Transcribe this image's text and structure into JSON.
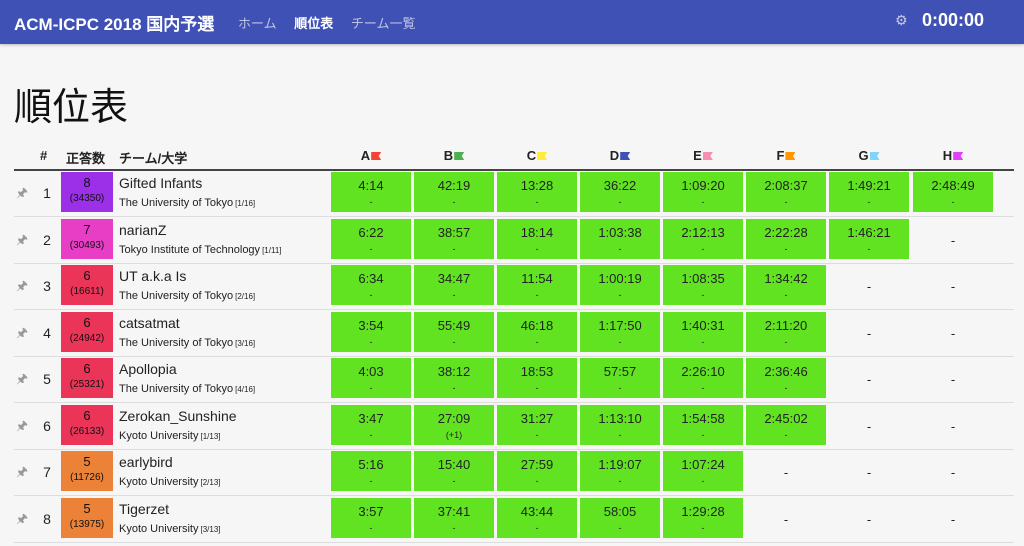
{
  "navbar": {
    "brand": "ACM-ICPC 2018 国内予選",
    "links": [
      "ホーム",
      "順位表",
      "チーム一覧"
    ],
    "active_index": 1,
    "timer": "0:00:00",
    "gear_icon": "gear-icon"
  },
  "page_title": "順位表",
  "headers": {
    "rank": "#",
    "solved": "正答数",
    "team": "チーム/大学"
  },
  "problems": [
    {
      "label": "A",
      "color": "#f44336"
    },
    {
      "label": "B",
      "color": "#4caf50"
    },
    {
      "label": "C",
      "color": "#ffeb3b"
    },
    {
      "label": "D",
      "color": "#3f51b5"
    },
    {
      "label": "E",
      "color": "#f48fb1"
    },
    {
      "label": "F",
      "color": "#ff9800"
    },
    {
      "label": "G",
      "color": "#81d4fa"
    },
    {
      "label": "H",
      "color": "#e040fb"
    }
  ],
  "colors": {
    "accepted": "#62e322",
    "header": "#3f51b5"
  },
  "teams": [
    {
      "rank": "1",
      "solved": "8",
      "penalty": "(34350)",
      "color": "#9b30e8",
      "name": "Gifted Infants",
      "university": "The University of Tokyo",
      "univ_rank": "[1/16]",
      "cells": [
        {
          "t": "4:14",
          "s": "-"
        },
        {
          "t": "42:19",
          "s": "-"
        },
        {
          "t": "13:28",
          "s": "-"
        },
        {
          "t": "36:22",
          "s": "-"
        },
        {
          "t": "1:09:20",
          "s": "-"
        },
        {
          "t": "2:08:37",
          "s": "-"
        },
        {
          "t": "1:49:21",
          "s": "-"
        },
        {
          "t": "2:48:49",
          "s": "-"
        }
      ]
    },
    {
      "rank": "2",
      "solved": "7",
      "penalty": "(30493)",
      "color": "#e83ec5",
      "name": "narianZ",
      "university": "Tokyo Institute of Technology",
      "univ_rank": "[1/11]",
      "cells": [
        {
          "t": "6:22",
          "s": "-"
        },
        {
          "t": "38:57",
          "s": "-"
        },
        {
          "t": "18:14",
          "s": "-"
        },
        {
          "t": "1:03:38",
          "s": "-"
        },
        {
          "t": "2:12:13",
          "s": "-"
        },
        {
          "t": "2:22:28",
          "s": "-"
        },
        {
          "t": "1:46:21",
          "s": "-"
        },
        {
          "t": "-",
          "s": ""
        }
      ]
    },
    {
      "rank": "3",
      "solved": "6",
      "penalty": "(16611)",
      "color": "#ea3458",
      "name": "UT a.k.a Is",
      "university": "The University of Tokyo",
      "univ_rank": "[2/16]",
      "cells": [
        {
          "t": "6:34",
          "s": "-"
        },
        {
          "t": "34:47",
          "s": "-"
        },
        {
          "t": "11:54",
          "s": "-"
        },
        {
          "t": "1:00:19",
          "s": "-"
        },
        {
          "t": "1:08:35",
          "s": "-"
        },
        {
          "t": "1:34:42",
          "s": "-"
        },
        {
          "t": "-",
          "s": ""
        },
        {
          "t": "-",
          "s": ""
        }
      ]
    },
    {
      "rank": "4",
      "solved": "6",
      "penalty": "(24942)",
      "color": "#ea3458",
      "name": "catsatmat",
      "university": "The University of Tokyo",
      "univ_rank": "[3/16]",
      "cells": [
        {
          "t": "3:54",
          "s": "-"
        },
        {
          "t": "55:49",
          "s": "-"
        },
        {
          "t": "46:18",
          "s": "-"
        },
        {
          "t": "1:17:50",
          "s": "-"
        },
        {
          "t": "1:40:31",
          "s": "-"
        },
        {
          "t": "2:11:20",
          "s": "-"
        },
        {
          "t": "-",
          "s": ""
        },
        {
          "t": "-",
          "s": ""
        }
      ]
    },
    {
      "rank": "5",
      "solved": "6",
      "penalty": "(25321)",
      "color": "#ea3458",
      "name": "Apollopia",
      "university": "The University of Tokyo",
      "univ_rank": "[4/16]",
      "cells": [
        {
          "t": "4:03",
          "s": "-"
        },
        {
          "t": "38:12",
          "s": "-"
        },
        {
          "t": "18:53",
          "s": "-"
        },
        {
          "t": "57:57",
          "s": "-"
        },
        {
          "t": "2:26:10",
          "s": "-"
        },
        {
          "t": "2:36:46",
          "s": "-"
        },
        {
          "t": "-",
          "s": ""
        },
        {
          "t": "-",
          "s": ""
        }
      ]
    },
    {
      "rank": "6",
      "solved": "6",
      "penalty": "(26133)",
      "color": "#ea3458",
      "name": "Zerokan_Sunshine",
      "university": "Kyoto University",
      "univ_rank": "[1/13]",
      "cells": [
        {
          "t": "3:47",
          "s": "-"
        },
        {
          "t": "27:09",
          "s": "(+1)"
        },
        {
          "t": "31:27",
          "s": "-"
        },
        {
          "t": "1:13:10",
          "s": "-"
        },
        {
          "t": "1:54:58",
          "s": "-"
        },
        {
          "t": "2:45:02",
          "s": "-"
        },
        {
          "t": "-",
          "s": ""
        },
        {
          "t": "-",
          "s": ""
        }
      ]
    },
    {
      "rank": "7",
      "solved": "5",
      "penalty": "(11726)",
      "color": "#ec8237",
      "name": "earlybird",
      "university": "Kyoto University",
      "univ_rank": "[2/13]",
      "cells": [
        {
          "t": "5:16",
          "s": "-"
        },
        {
          "t": "15:40",
          "s": "-"
        },
        {
          "t": "27:59",
          "s": "-"
        },
        {
          "t": "1:19:07",
          "s": "-"
        },
        {
          "t": "1:07:24",
          "s": "-"
        },
        {
          "t": "-",
          "s": ""
        },
        {
          "t": "-",
          "s": ""
        },
        {
          "t": "-",
          "s": ""
        }
      ]
    },
    {
      "rank": "8",
      "solved": "5",
      "penalty": "(13975)",
      "color": "#ec8237",
      "name": "Tigerzet",
      "university": "Kyoto University",
      "univ_rank": "[3/13]",
      "cells": [
        {
          "t": "3:57",
          "s": "-"
        },
        {
          "t": "37:41",
          "s": "-"
        },
        {
          "t": "43:44",
          "s": "-"
        },
        {
          "t": "58:05",
          "s": "-"
        },
        {
          "t": "1:29:28",
          "s": "-"
        },
        {
          "t": "-",
          "s": ""
        },
        {
          "t": "-",
          "s": ""
        },
        {
          "t": "-",
          "s": ""
        }
      ]
    }
  ]
}
